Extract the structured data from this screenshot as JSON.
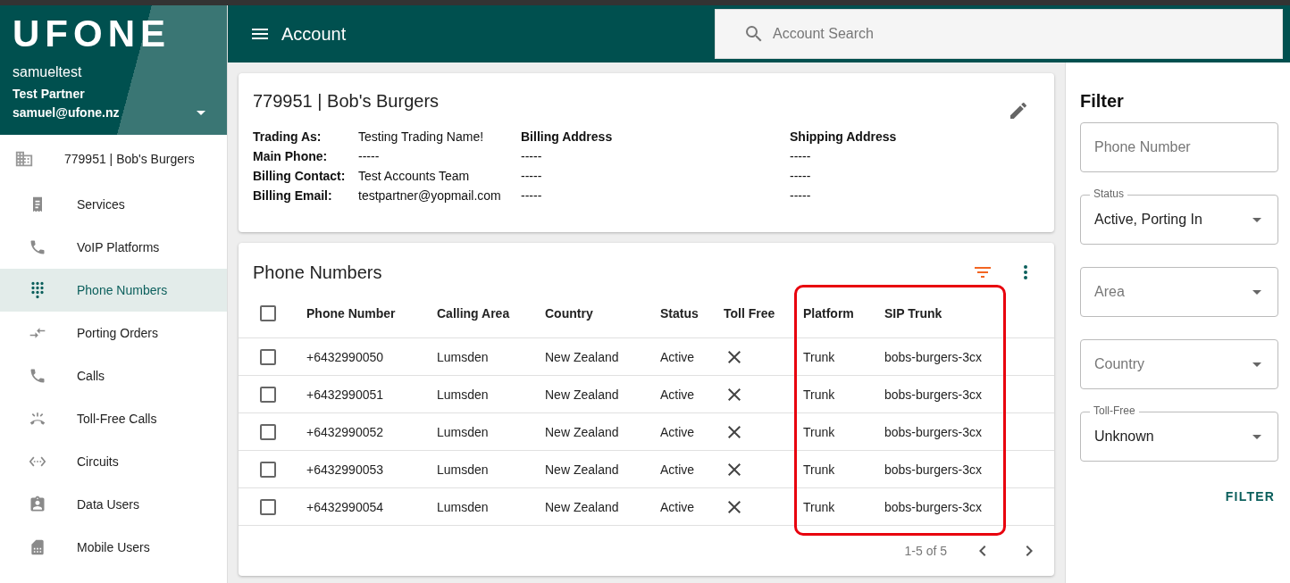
{
  "sidebar": {
    "logo": "UFONE",
    "user": {
      "name": "samueltest",
      "partner": "Test Partner",
      "email": "samuel@ufone.nz"
    },
    "account": "779951 | Bob's Burgers",
    "items": [
      {
        "label": "Services",
        "selected": false
      },
      {
        "label": "VoIP Platforms",
        "selected": false
      },
      {
        "label": "Phone Numbers",
        "selected": true
      },
      {
        "label": "Porting Orders",
        "selected": false
      },
      {
        "label": "Calls",
        "selected": false
      },
      {
        "label": "Toll-Free Calls",
        "selected": false
      },
      {
        "label": "Circuits",
        "selected": false
      },
      {
        "label": "Data Users",
        "selected": false
      },
      {
        "label": "Mobile Users",
        "selected": false
      }
    ]
  },
  "header": {
    "title": "Account",
    "search": {
      "placeholder": "Account Search"
    }
  },
  "account_card": {
    "title": "779951 | Bob's Burgers",
    "fields": [
      {
        "label": "Trading As:",
        "value": "Testing Trading Name!"
      },
      {
        "label": "Main Phone:",
        "value": "-----"
      },
      {
        "label": "Billing Contact:",
        "value": "Test Accounts Team"
      },
      {
        "label": "Billing Email:",
        "value": "testpartner@yopmail.com"
      }
    ],
    "billing_address": {
      "heading": "Billing Address",
      "lines": [
        "-----",
        "-----",
        "-----"
      ]
    },
    "shipping_address": {
      "heading": "Shipping Address",
      "lines": [
        "-----",
        "-----",
        "-----"
      ]
    }
  },
  "phone_numbers": {
    "title": "Phone Numbers",
    "select_all_checked": false,
    "columns": [
      {
        "label": "Phone Number",
        "highlighted": false
      },
      {
        "label": "Calling Area",
        "highlighted": false
      },
      {
        "label": "Country",
        "highlighted": false
      },
      {
        "label": "Status",
        "highlighted": false
      },
      {
        "label": "Toll Free",
        "highlighted": false
      },
      {
        "label": "Platform",
        "highlighted": true
      },
      {
        "label": "SIP Trunk",
        "highlighted": true
      }
    ],
    "rows": [
      {
        "checked": false,
        "phone_number": "+6432990050",
        "calling_area": "Lumsden",
        "country": "New Zealand",
        "status": "Active",
        "toll_free": false,
        "platform": "Trunk",
        "sip_trunk": "bobs-burgers-3cx"
      },
      {
        "checked": false,
        "phone_number": "+6432990051",
        "calling_area": "Lumsden",
        "country": "New Zealand",
        "status": "Active",
        "toll_free": false,
        "platform": "Trunk",
        "sip_trunk": "bobs-burgers-3cx"
      },
      {
        "checked": false,
        "phone_number": "+6432990052",
        "calling_area": "Lumsden",
        "country": "New Zealand",
        "status": "Active",
        "toll_free": false,
        "platform": "Trunk",
        "sip_trunk": "bobs-burgers-3cx"
      },
      {
        "checked": false,
        "phone_number": "+6432990053",
        "calling_area": "Lumsden",
        "country": "New Zealand",
        "status": "Active",
        "toll_free": false,
        "platform": "Trunk",
        "sip_trunk": "bobs-burgers-3cx"
      },
      {
        "checked": false,
        "phone_number": "+6432990054",
        "calling_area": "Lumsden",
        "country": "New Zealand",
        "status": "Active",
        "toll_free": false,
        "platform": "Trunk",
        "sip_trunk": "bobs-burgers-3cx"
      }
    ],
    "pagination": "1-5 of 5"
  },
  "filter": {
    "title": "Filter",
    "fields": [
      {
        "kind": "text",
        "placeholder": "Phone Number"
      },
      {
        "kind": "select",
        "label": "Status",
        "value": "Active, Porting In"
      },
      {
        "kind": "select",
        "placeholder": "Area"
      },
      {
        "kind": "select",
        "placeholder": "Country"
      },
      {
        "kind": "select",
        "label": "Toll-Free",
        "value": "Unknown"
      }
    ],
    "button": "FILTER"
  }
}
